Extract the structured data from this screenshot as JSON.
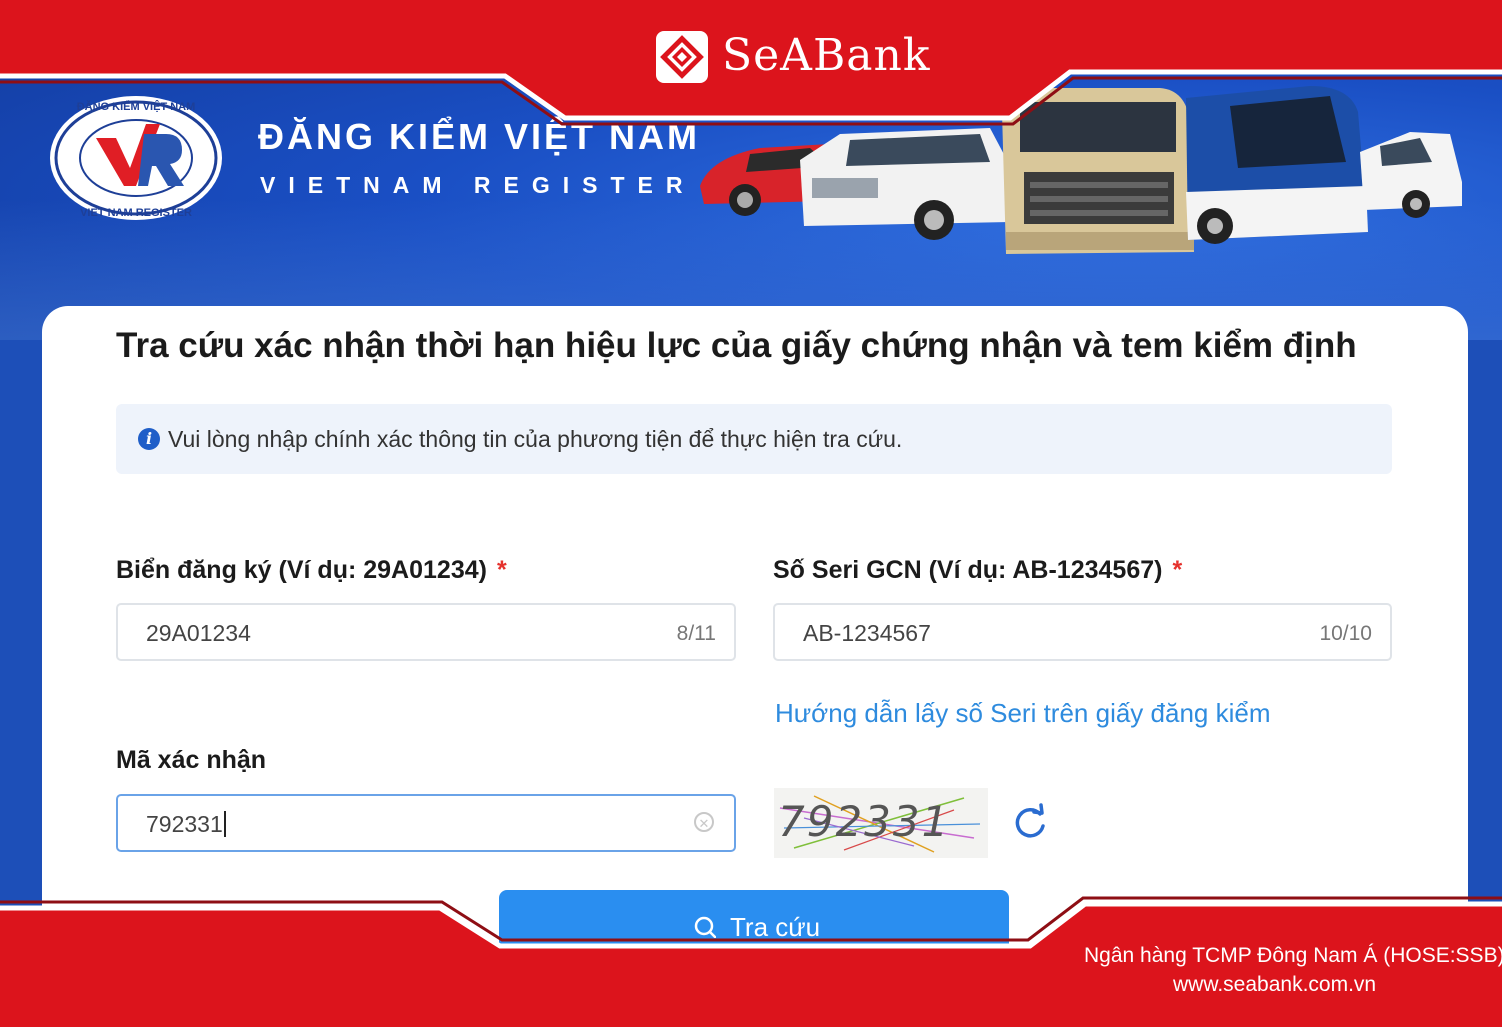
{
  "bank": {
    "name": "SeABank",
    "footer_line1": "Ngân hàng TCMP Đông Nam Á (HOSE:SSB)",
    "footer_line2": "www.seabank.com.vn"
  },
  "header": {
    "logo_ring_top": "ĐĂNG KIỂM VIỆT NAM",
    "logo_ring_bottom": "VIET NAM REGISTER",
    "title": "ĐĂNG KIỂM VIỆT NAM",
    "subtitle": "VIETNAM REGISTER"
  },
  "form": {
    "title": "Tra cứu xác nhận thời hạn hiệu lực của giấy chứng nhận và tem kiểm định",
    "notice": "Vui lòng nhập chính xác thông tin của phương tiện để thực hiện tra cứu.",
    "plate": {
      "label": "Biển đăng ký (Ví dụ: 29A01234)",
      "required_mark": "*",
      "value": "29A01234",
      "counter": "8/11"
    },
    "serial": {
      "label": "Số Seri GCN (Ví dụ: AB-1234567)",
      "required_mark": "*",
      "value": "AB-1234567",
      "counter": "10/10"
    },
    "serial_help_link": "Hướng dẫn lấy số Seri trên giấy đăng kiểm",
    "captcha": {
      "label": "Mã xác nhận",
      "value": "792331",
      "image_text": "792331"
    },
    "submit_label": "Tra cứu"
  },
  "colors": {
    "seabank_red": "#dc141c",
    "hero_blue": "#1a4fc4",
    "primary_button": "#2a8ef0",
    "link": "#2e8bde",
    "required": "#e5322d"
  }
}
